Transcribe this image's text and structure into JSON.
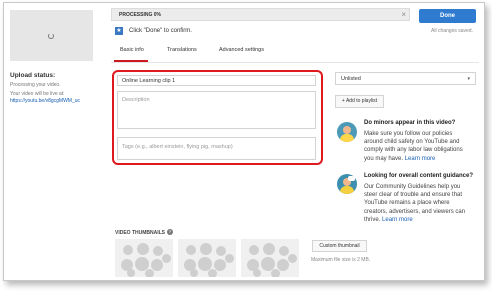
{
  "left_panel": {
    "upload_status_label": "Upload status:",
    "processing_text": "Processing your video.",
    "live_text": "Your video will be live at:",
    "video_url": "https://youtu.be/v8gcgMWM_uc"
  },
  "progress": {
    "label": "PROCESSING 0%",
    "percent": 0,
    "close_icon": "×"
  },
  "header": {
    "done_label": "Done",
    "saved_text": "All changes saved.",
    "star_icon": "★",
    "click_done_text": "Click \"Done\" to confirm."
  },
  "tabs": [
    {
      "label": "Basic info",
      "active": true
    },
    {
      "label": "Translations",
      "active": false
    },
    {
      "label": "Advanced settings",
      "active": false
    }
  ],
  "form": {
    "title_value": "Online Learning clip 1",
    "description_placeholder": "Description",
    "tags_placeholder": "Tags (e.g., albert einstein, flying pig, mashup)"
  },
  "sidebar": {
    "privacy_value": "Unlisted",
    "caret_icon": "▾",
    "add_to_playlist_label": "+ Add to playlist",
    "minors": {
      "title": "Do minors appear in this video?",
      "lines": [
        "Make sure you follow our policies",
        "around child safety on YouTube and",
        "comply with any labor law obligations"
      ],
      "last_line": "you may have.",
      "learn_more": "Learn more"
    },
    "guidance": {
      "title": "Looking for overall content guidance?",
      "lines": [
        "Our Community Guidelines help you",
        "steer clear of trouble and ensure that",
        "YouTube remains a place where",
        "creators, advertisers, and viewers can"
      ],
      "last_line": "thrive.",
      "learn_more": "Learn more"
    }
  },
  "thumbnails": {
    "label": "VIDEO THUMBNAILS",
    "help_icon": "?",
    "custom_label": "Custom thumbnail",
    "max_size_text": "Maximum file size is 2 MB."
  },
  "colors": {
    "accent_blue": "#2e7bcf",
    "highlight_red": "#e0191e",
    "tab_underline": "#cc181e"
  }
}
